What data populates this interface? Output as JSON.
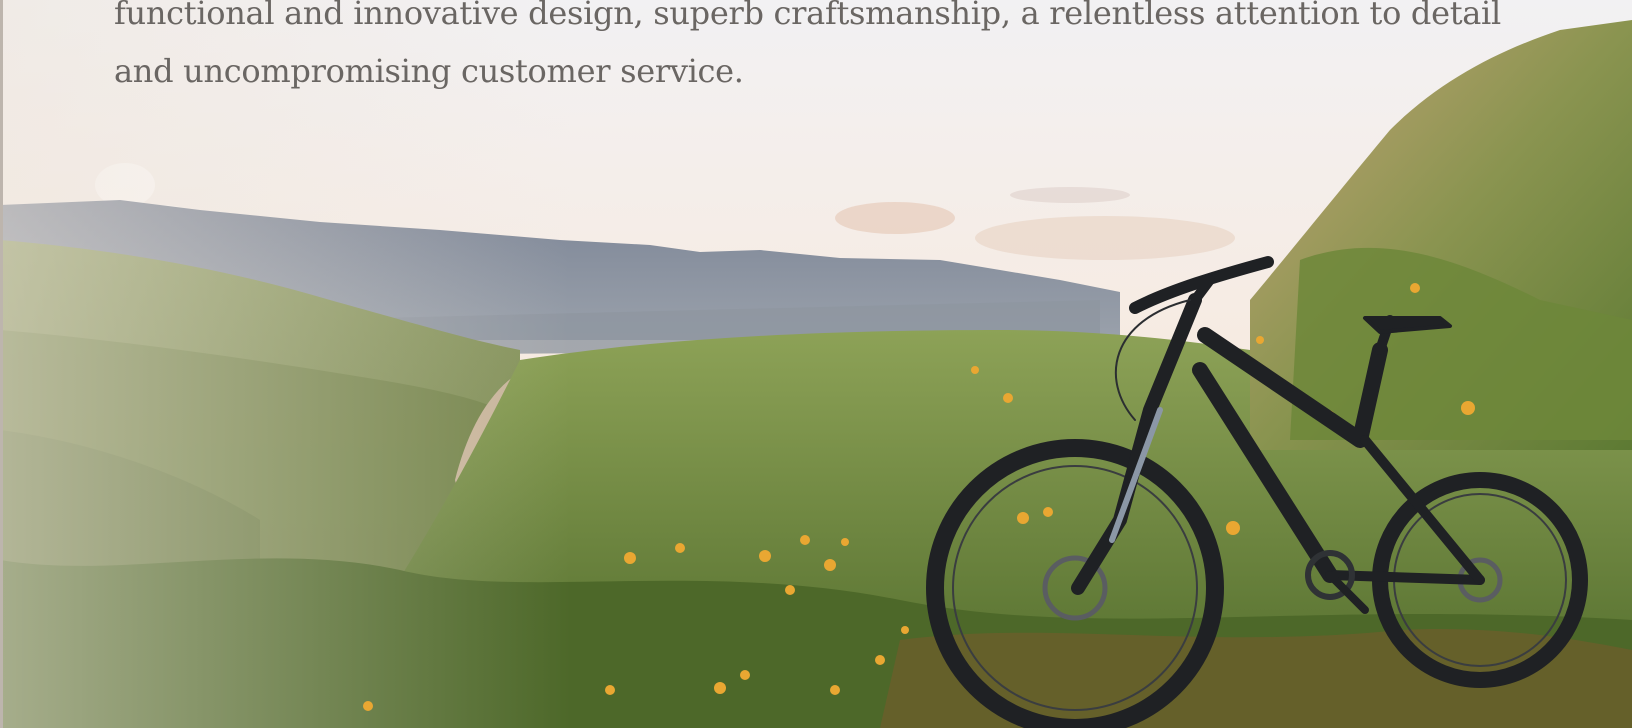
{
  "hero": {
    "image_icon": "mountain-bike-landscape-photo",
    "copy_lines": [
      "functional and innovative design, superb craftsmanship, a relentless attention to detail",
      "and uncompromising customer service."
    ]
  },
  "colors": {
    "sky_top": "#f1f0f2",
    "sky_mid": "#f6e9dc",
    "mountain": "#6f7a8a",
    "hill_green": "#7e9155",
    "grass": "#5f7c34",
    "flower": "#e7a531",
    "bike": "#1f2124",
    "text": "#6a6663"
  }
}
